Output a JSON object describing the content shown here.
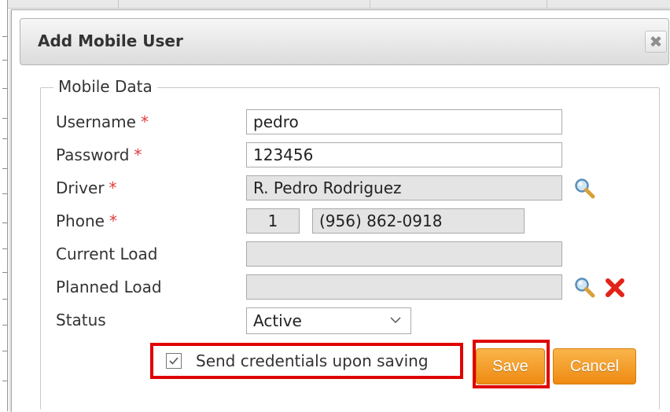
{
  "dialog": {
    "title": "Add Mobile User",
    "close_symbol": "✖"
  },
  "fieldset": {
    "legend": "Mobile Data"
  },
  "form": {
    "username": {
      "label": "Username",
      "required_mark": "*",
      "value": "pedro"
    },
    "password": {
      "label": "Password",
      "required_mark": "*",
      "value": "123456"
    },
    "driver": {
      "label": "Driver",
      "required_mark": "*",
      "value": "R. Pedro Rodriguez",
      "icon": "magnifier-icon"
    },
    "phone": {
      "label": "Phone",
      "required_mark": "*",
      "country_code": "1",
      "number": "(956) 862-0918"
    },
    "current_load": {
      "label": "Current Load",
      "value": ""
    },
    "planned_load": {
      "label": "Planned Load",
      "value": "",
      "icons": [
        "magnifier-icon",
        "red-x-icon"
      ]
    },
    "status": {
      "label": "Status",
      "value": "Active"
    }
  },
  "send_credentials": {
    "label": "Send credentials upon saving",
    "checked": true
  },
  "buttons": {
    "save": "Save",
    "cancel": "Cancel"
  },
  "colors": {
    "required": "#e23b3b",
    "button_orange": "#ef8a12",
    "highlight_red": "#e00000",
    "readonly_bg": "#e4e4e4"
  }
}
